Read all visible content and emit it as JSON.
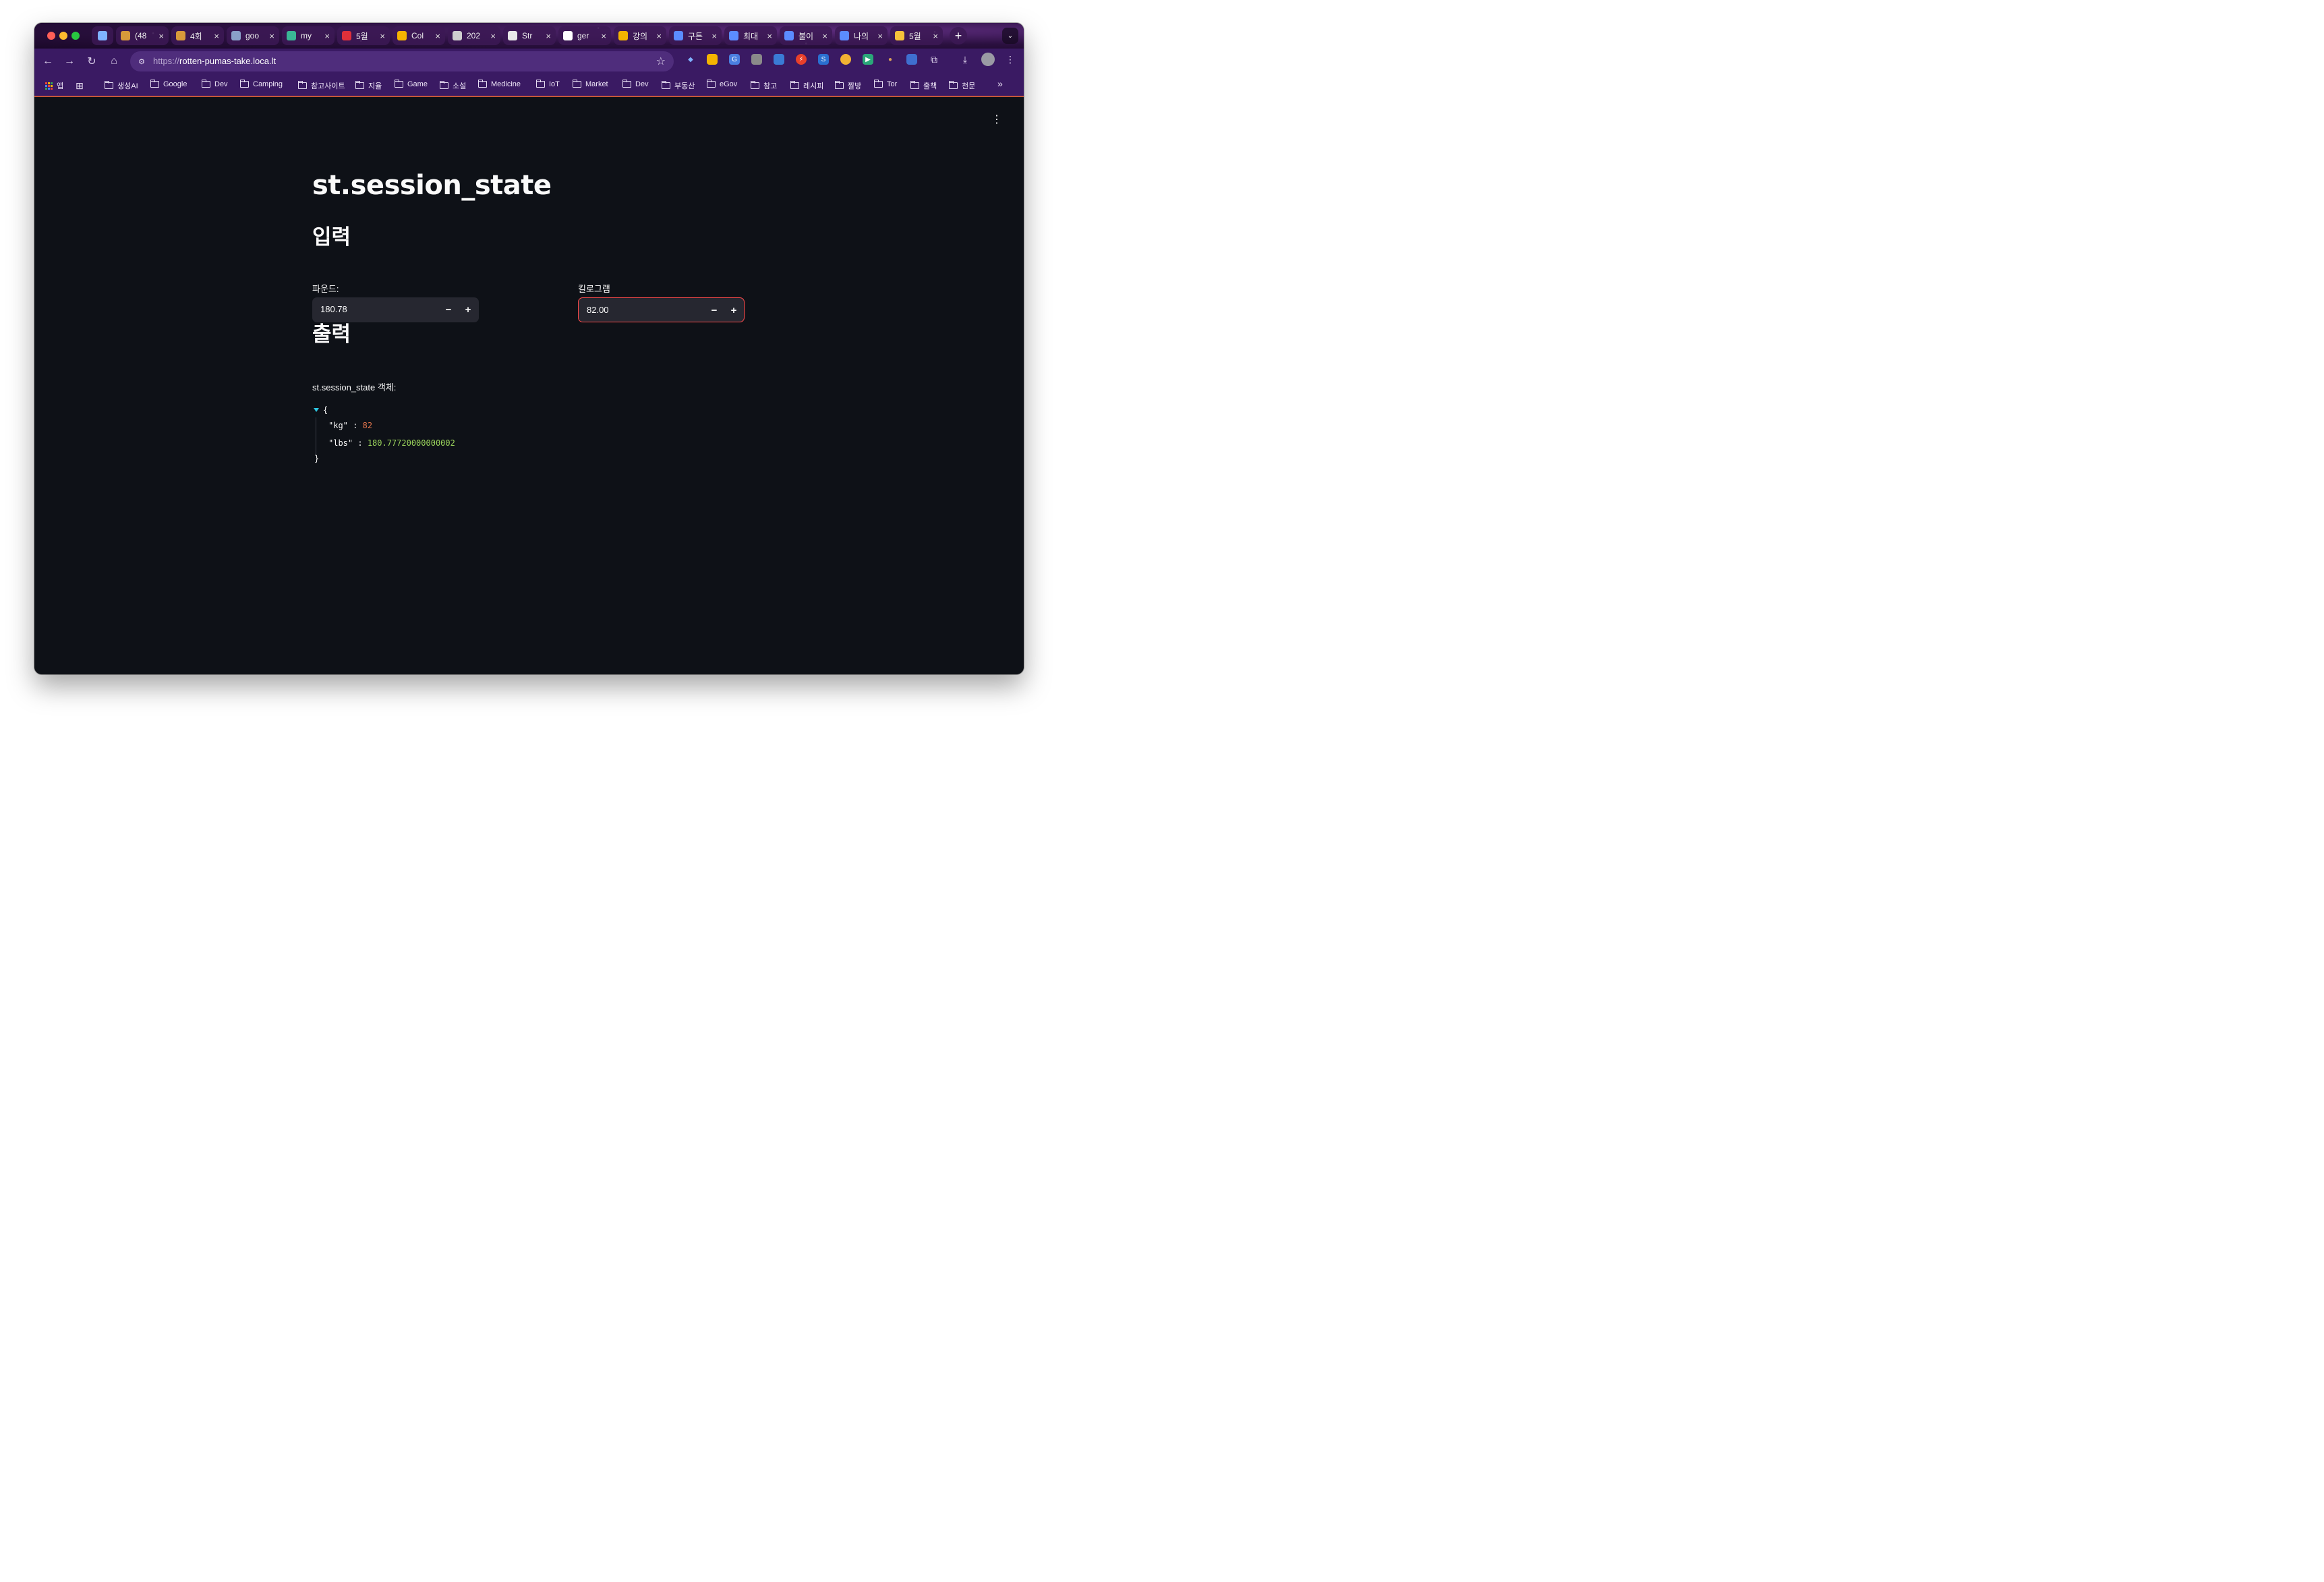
{
  "browser": {
    "tabs": [
      {
        "title": "",
        "icon": "gem-icon",
        "color": "#7fb2ff",
        "pinned": true
      },
      {
        "title": "(48",
        "icon": "box-icon",
        "color": "#d89a3a"
      },
      {
        "title": "4회",
        "icon": "box-icon",
        "color": "#d89a3a"
      },
      {
        "title": "goo",
        "icon": "monitor-icon",
        "color": "#8aa0c8"
      },
      {
        "title": "my",
        "icon": "v-icon",
        "color": "#3ab795"
      },
      {
        "title": "5월",
        "icon": "hundred-icon",
        "color": "#e0303a"
      },
      {
        "title": "Col",
        "icon": "drive-icon",
        "color": "#f4b400"
      },
      {
        "title": "202",
        "icon": "infinity-icon",
        "color": "#cfcfcf"
      },
      {
        "title": "Str",
        "icon": "crown-icon",
        "color": "#e8e8e8"
      },
      {
        "title": "ger",
        "icon": "github-icon",
        "color": "#ffffff"
      },
      {
        "title": "강의",
        "icon": "drive-icon",
        "color": "#f4b400"
      },
      {
        "title": "구튼",
        "icon": "arrow-icon",
        "color": "#5b8cff"
      },
      {
        "title": "최대",
        "icon": "arrow-icon",
        "color": "#5b8cff"
      },
      {
        "title": "불이",
        "icon": "arrow-icon",
        "color": "#5b8cff"
      },
      {
        "title": "나의",
        "icon": "arrow-icon",
        "color": "#5b8cff"
      },
      {
        "title": "5월",
        "icon": "emoji-icon",
        "color": "#f7c23a"
      }
    ],
    "address": {
      "scheme": "https://",
      "host": "rotten-pumas-take.loca.lt"
    },
    "bookmarks_apps_label": "앱",
    "bookmarks": [
      "생성AI",
      "Google",
      "Dev",
      "Camping",
      "참고사이트",
      "지율",
      "Game",
      "소설",
      "Medicine",
      "IoT",
      "Market",
      "Dev",
      "부동산",
      "eGov",
      "참고",
      "레시피",
      "짤방",
      "Tor",
      "출책",
      "천문"
    ],
    "bookmarks_overflow": "»"
  },
  "app": {
    "title": "st.session_state",
    "input_header": "입력",
    "pounds_label": "파운드:",
    "pounds_value": "180.78",
    "kg_label": "킬로그램",
    "kg_value": "82.00",
    "output_header": "출력",
    "object_caption": "st.session_state 객체:",
    "json": {
      "open": "{",
      "kg_key": "\"kg\"",
      "kg_value": "82",
      "lbs_key": "\"lbs\"",
      "lbs_value": "180.77720000000002",
      "close": "}"
    },
    "minus": "−",
    "plus": "+"
  },
  "colors": {
    "accent": "#ff4b4b",
    "page_bg": "#0e1117",
    "input_bg": "#262730",
    "json_int": "#e0744c",
    "json_float": "#9bd45c"
  }
}
